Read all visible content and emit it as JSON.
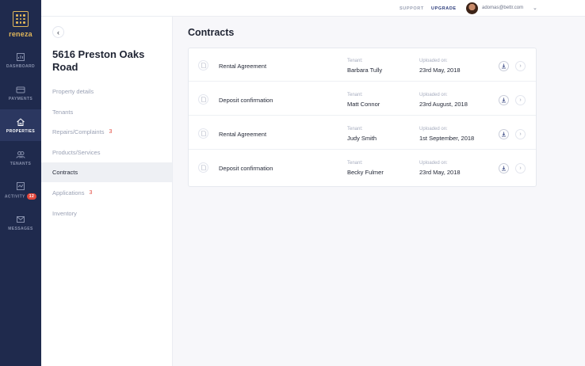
{
  "app": {
    "logo_text": "reneza",
    "accent": "#e0b65a"
  },
  "nav": {
    "items": [
      {
        "label": "DASHBOARD",
        "icon": "dashboard-icon"
      },
      {
        "label": "PAYMENTS",
        "icon": "payments-icon"
      },
      {
        "label": "PROPERTIES",
        "icon": "home-icon",
        "active": true
      },
      {
        "label": "TENANTS",
        "icon": "tenants-icon"
      },
      {
        "label": "ACTIVITY",
        "icon": "activity-icon",
        "badge": "12"
      },
      {
        "label": "MESSAGES",
        "icon": "messages-icon"
      }
    ]
  },
  "topbar": {
    "support": "SUPPORT",
    "upgrade": "UPGRADE",
    "email": "adomas@bettr.com",
    "caret": "⌄"
  },
  "property": {
    "back": "‹",
    "title": "5616 Preston Oaks Road",
    "menu": [
      {
        "label": "Property details"
      },
      {
        "label": "Tenants"
      },
      {
        "label": "Repairs/Complaints",
        "count": "3"
      },
      {
        "label": "Products/Services"
      },
      {
        "label": "Contracts",
        "active": true
      },
      {
        "label": "Applications",
        "count": "3"
      },
      {
        "label": "Inventory"
      }
    ]
  },
  "main": {
    "title": "Contracts",
    "tenant_label": "Tenant:",
    "uploaded_label": "Uploaded on:",
    "arrow": "›",
    "contracts": [
      {
        "name": "Rental Agreement",
        "tenant": "Barbara Tully",
        "uploaded": "23rd May, 2018"
      },
      {
        "name": "Deposit confirmation",
        "tenant": "Matt Connor",
        "uploaded": "23rd August, 2018"
      },
      {
        "name": "Rental Agreement",
        "tenant": "Judy Smith",
        "uploaded": "1st September, 2018"
      },
      {
        "name": "Deposit confirmation",
        "tenant": "Becky Fulmer",
        "uploaded": "23rd May, 2018"
      }
    ]
  },
  "colors": {
    "nav_bg": "#1f2a4d",
    "badge": "#e2483d",
    "upgrade": "#2b3b7a"
  }
}
